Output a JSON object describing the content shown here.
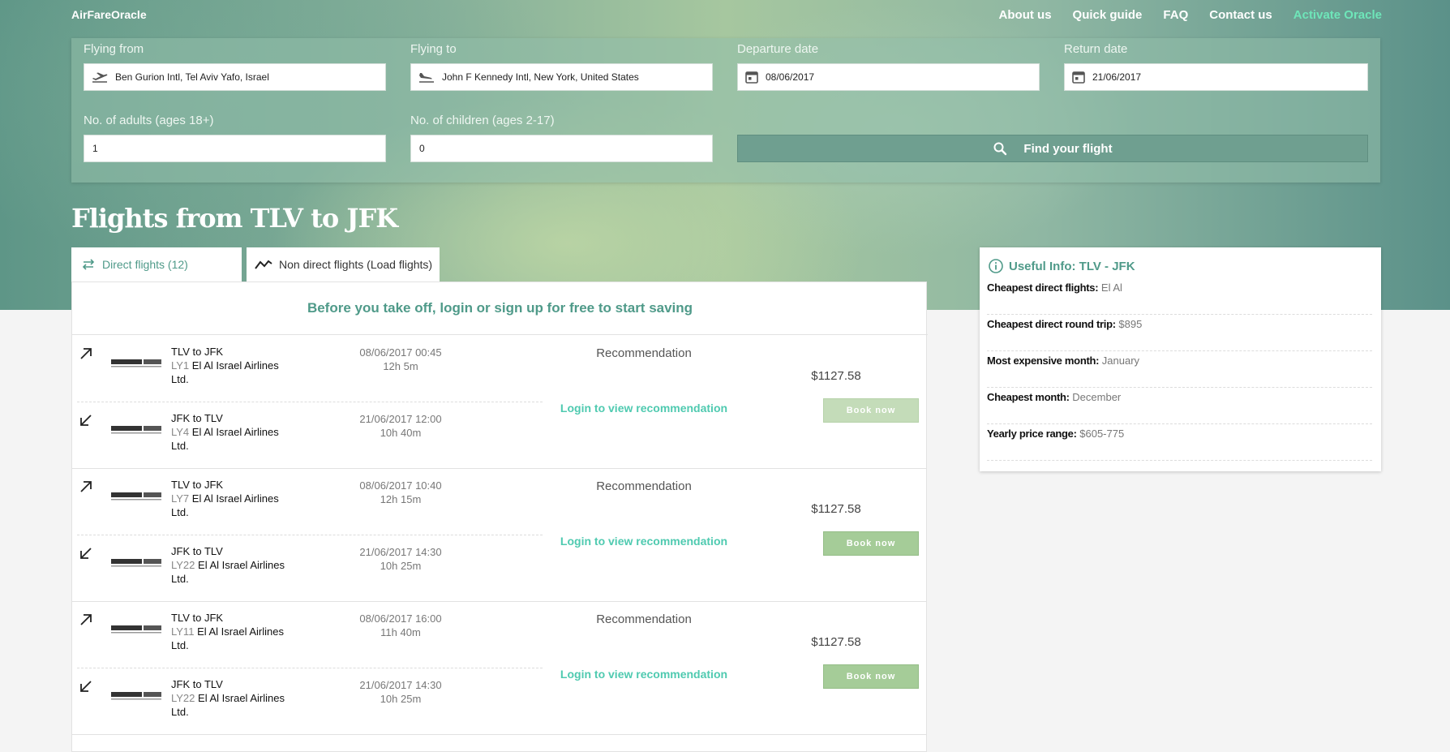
{
  "nav": {
    "brand": "AirFareOracle",
    "links": [
      "About us",
      "Quick guide",
      "FAQ",
      "Contact us"
    ],
    "accent_link": "Activate Oracle"
  },
  "search": {
    "from_label": "Flying from",
    "from_value": "Ben Gurion Intl, Tel Aviv Yafo, Israel",
    "to_label": "Flying to",
    "to_value": "John F Kennedy Intl, New York, United States",
    "departure_label": "Departure date",
    "departure_value": "08/06/2017",
    "return_label": "Return date",
    "return_value": "21/06/2017",
    "adults_label": "No. of adults (ages 18+)",
    "adults_value": "1",
    "children_label": "No. of children (ages 2-17)",
    "children_value": "0",
    "find_button": "Find your flight"
  },
  "page_title": "Flights from TLV to JFK",
  "tabs": {
    "direct": "Direct flights (12)",
    "non_direct": "Non direct flights (Load flights)"
  },
  "promo": "Before you take off, login or sign up for free to start saving",
  "results": [
    {
      "outbound": {
        "route": "TLV to JFK",
        "number": "LY1",
        "airline": "El Al Israel Airlines Ltd.",
        "datetime": "08/06/2017 00:45",
        "duration": "12h 5m"
      },
      "return": {
        "route": "JFK to TLV",
        "number": "LY4",
        "airline": "El Al Israel Airlines Ltd.",
        "datetime": "21/06/2017 12:00",
        "duration": "10h 40m"
      },
      "recommendation": "Recommendation",
      "login_text": "Login to view recommendation",
      "price": "$1127.58",
      "book": "Book now"
    },
    {
      "outbound": {
        "route": "TLV to JFK",
        "number": "LY7",
        "airline": "El Al Israel Airlines Ltd.",
        "datetime": "08/06/2017 10:40",
        "duration": "12h 15m"
      },
      "return": {
        "route": "JFK to TLV",
        "number": "LY22",
        "airline": "El Al Israel Airlines Ltd.",
        "datetime": "21/06/2017 14:30",
        "duration": "10h 25m"
      },
      "recommendation": "Recommendation",
      "login_text": "Login to view recommendation",
      "price": "$1127.58",
      "book": "Book now"
    },
    {
      "outbound": {
        "route": "TLV to JFK",
        "number": "LY11",
        "airline": "El Al Israel Airlines Ltd.",
        "datetime": "08/06/2017 16:00",
        "duration": "11h 40m"
      },
      "return": {
        "route": "JFK to TLV",
        "number": "LY22",
        "airline": "El Al Israel Airlines Ltd.",
        "datetime": "21/06/2017 14:30",
        "duration": "10h 25m"
      },
      "recommendation": "Recommendation",
      "login_text": "Login to view recommendation",
      "price": "$1127.58",
      "book": "Book now"
    }
  ],
  "info": {
    "title": "Useful Info: TLV - JFK",
    "rows": [
      {
        "k": "Cheapest direct flights:",
        "v": "El Al"
      },
      {
        "k": "Cheapest direct round trip:",
        "v": "$895"
      },
      {
        "k": "Most expensive month:",
        "v": "January"
      },
      {
        "k": "Cheapest month:",
        "v": "December"
      },
      {
        "k": "Yearly price range:",
        "v": "$605-775"
      }
    ]
  },
  "colors": {
    "accent_teal": "#4f9a89",
    "login_green": "#4fcab0",
    "book_green": "#a5cc98",
    "nav_accent": "#6ee6b9"
  },
  "icons": {
    "from": "plane-takeoff-icon",
    "to": "plane-landing-icon",
    "date": "calendar-icon",
    "search": "search-icon",
    "direct_tab": "swap-arrows-icon",
    "nondirect_tab": "zigzag-route-icon",
    "outbound": "arrow-up-right-icon",
    "return": "arrow-down-left-icon",
    "info": "info-circle-icon"
  }
}
